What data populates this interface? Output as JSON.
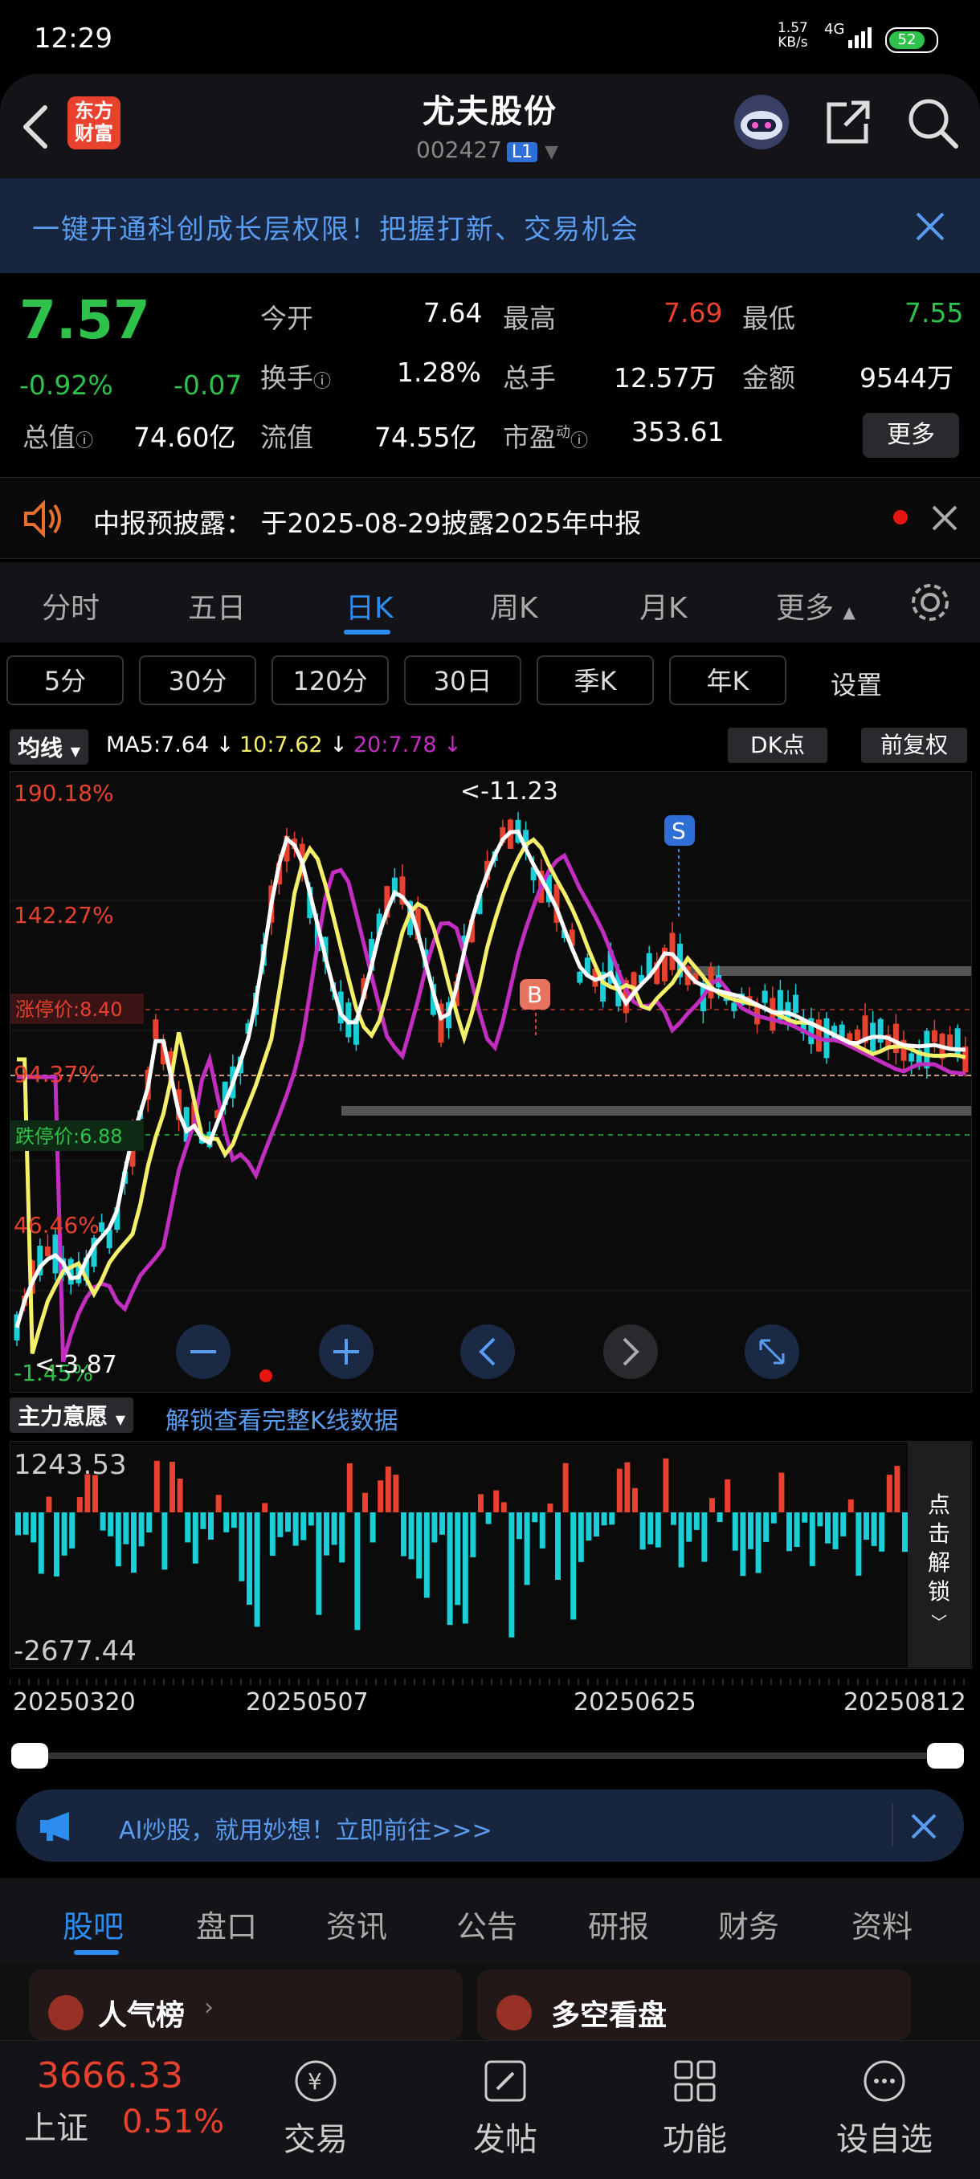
{
  "status": {
    "time": "12:29",
    "net_speed": "1.57",
    "net_unit": "KB/s",
    "network": "4G",
    "battery": "52"
  },
  "header": {
    "title": "尤夫股份",
    "code": "002427",
    "level": "L1",
    "logo_line1": "东方",
    "logo_line2": "财富"
  },
  "banner": {
    "text": "一键开通科创成长层权限！把握打新、交易机会"
  },
  "quote": {
    "price": "7.57",
    "pct": "-0.92%",
    "chg": "-0.07",
    "open_label": "今开",
    "open": "7.64",
    "high_label": "最高",
    "high": "7.69",
    "low_label": "最低",
    "low": "7.55",
    "turnover_label": "换手",
    "turnover": "1.28%",
    "vol_label": "总手",
    "vol": "12.57万",
    "amt_label": "金额",
    "amt": "9544万",
    "mcap_label": "总值",
    "mcap": "74.60亿",
    "float_label": "流值",
    "float": "74.55亿",
    "pe_label": "市盈",
    "pe_sup": "动",
    "pe": "353.61",
    "more": "更多"
  },
  "notice": {
    "text": "中报预披露： 于2025-08-29披露2025年中报"
  },
  "period_tabs": [
    "分时",
    "五日",
    "日K",
    "周K",
    "月K",
    "更多"
  ],
  "active_period": "日K",
  "sub_periods": [
    "5分",
    "30分",
    "120分",
    "30日",
    "季K",
    "年K"
  ],
  "settings_label": "设置",
  "ma_bar": {
    "indicator": "均线",
    "ma5": "MA5:7.64",
    "ma10": "10:7.62",
    "ma20": "20:7.78",
    "dk": "DK点",
    "adjust": "前复权"
  },
  "chart_labels": {
    "y_top": "190.18%",
    "y_2": "142.27%",
    "limit_up": "涨停价:8.40",
    "y_3": "94.37%",
    "limit_down": "跌停价:6.88",
    "y_4": "46.46%",
    "y_bottom": "-1.45%",
    "high_mark": "<-11.23",
    "low_mark": "<-3.87",
    "buy": "B",
    "sell": "S"
  },
  "sub_chart": {
    "indicator": "主力意愿",
    "unlock_link": "解锁查看完整K线数据",
    "max": "1243.53",
    "min": "-2677.44",
    "unlock_v": [
      "点",
      "击",
      "解",
      "锁"
    ]
  },
  "dates": [
    "20250320",
    "20250507",
    "20250625",
    "20250812"
  ],
  "ad": {
    "text": "AI炒股，就用妙想！立即前往>>>"
  },
  "bottom_tabs": [
    "股吧",
    "盘口",
    "资讯",
    "公告",
    "研报",
    "财务",
    "资料"
  ],
  "cards": {
    "left": "人气榜",
    "right": "多空看盘"
  },
  "footer": {
    "index_value": "3666.33",
    "index_name": "上证",
    "index_pct": "0.51%",
    "trade": "交易",
    "post": "发帖",
    "func": "功能",
    "watch": "设自选"
  },
  "colors": {
    "up": "#e8412e",
    "down": "#19d0d8",
    "ma5": "#ffffff",
    "ma10": "#f4f06a",
    "ma20": "#c22ec0",
    "accent": "#2d8cf0"
  }
}
